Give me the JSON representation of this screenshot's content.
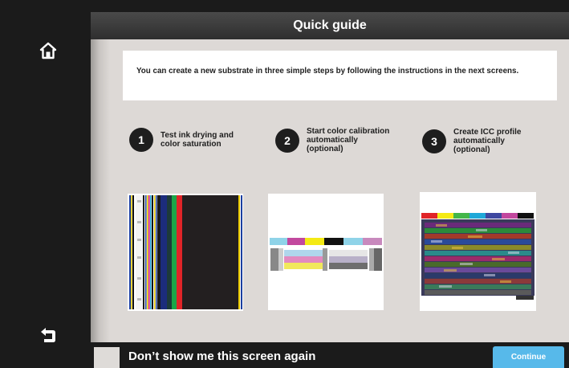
{
  "header": {
    "title": "Quick guide"
  },
  "sidebar": {
    "home_icon": "home-icon",
    "back_icon": "back-arrow-icon"
  },
  "info": {
    "text": "You can create a new substrate in three simple steps by following the instructions in the next screens."
  },
  "steps": [
    {
      "number": "1",
      "label": "Test ink drying and\ncolor saturation"
    },
    {
      "number": "2",
      "label": "Start color calibration\nautomatically\n(optional)"
    },
    {
      "number": "3",
      "label": "Create ICC profile\nautomatically\n(optional)"
    }
  ],
  "footer": {
    "dont_show_label": "Don’t show me this screen again",
    "continue_label": "Continue"
  },
  "colors": {
    "accent": "#57b9ea",
    "header_bg": "#3a3a3a",
    "panel_bg": "#ddd9d6",
    "dark": "#1b1b1b"
  }
}
